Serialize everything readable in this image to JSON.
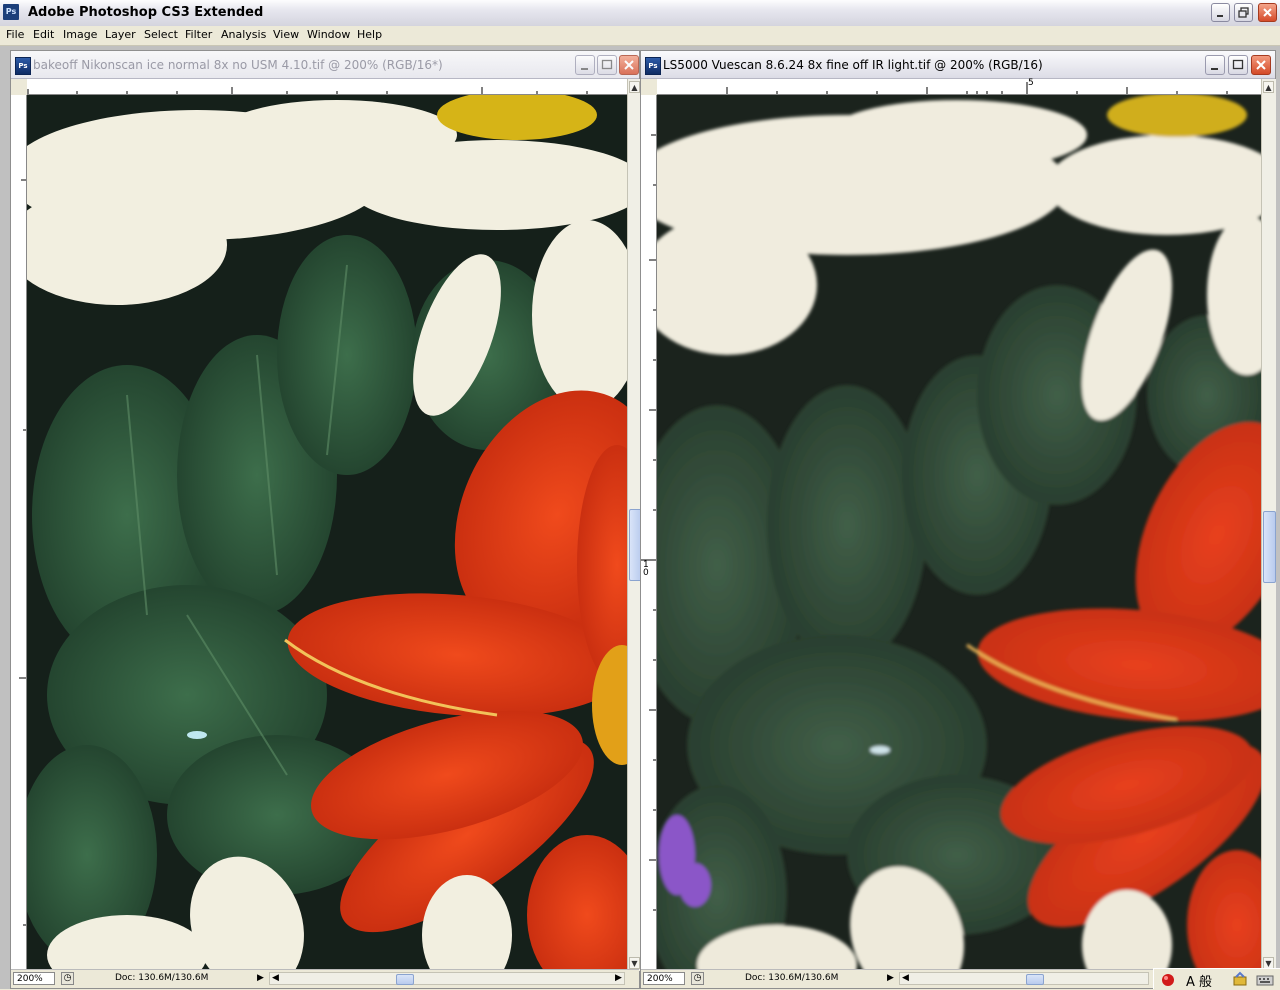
{
  "app": {
    "title": "Adobe Photoshop CS3 Extended",
    "logo_text": "Ps"
  },
  "menu": [
    "File",
    "Edit",
    "Image",
    "Layer",
    "Select",
    "Filter",
    "Analysis",
    "View",
    "Window",
    "Help"
  ],
  "documents": [
    {
      "title": "bakeoff Nikonscan ice normal 8x no USM 4.10.tif @ 200% (RGB/16*)",
      "active": false,
      "zoom": "200%",
      "doc_size": "Doc: 130.6M/130.6M",
      "icon_text": "Ps"
    },
    {
      "title": "LS5000 Vuescan 8.6.24 8x fine off IR light.tif @ 200% (RGB/16)",
      "active": true,
      "zoom": "200%",
      "doc_size": "Doc: 130.6M/130.6M",
      "icon_text": "Ps",
      "ruler_top_label": "5",
      "ruler_left_label": "1\n0"
    }
  ],
  "tray": {
    "ime_label": "A 般",
    "icons": [
      "red-ball-icon",
      "ime-icon",
      "tool-icon",
      "keyboard-icon"
    ]
  },
  "colors": {
    "petal_red": "#e23a16",
    "leaf_green": "#2f5a3a",
    "daisy_white": "#f3f0e1",
    "center_yellow": "#d9b81a",
    "background_dark": "#16201a"
  }
}
